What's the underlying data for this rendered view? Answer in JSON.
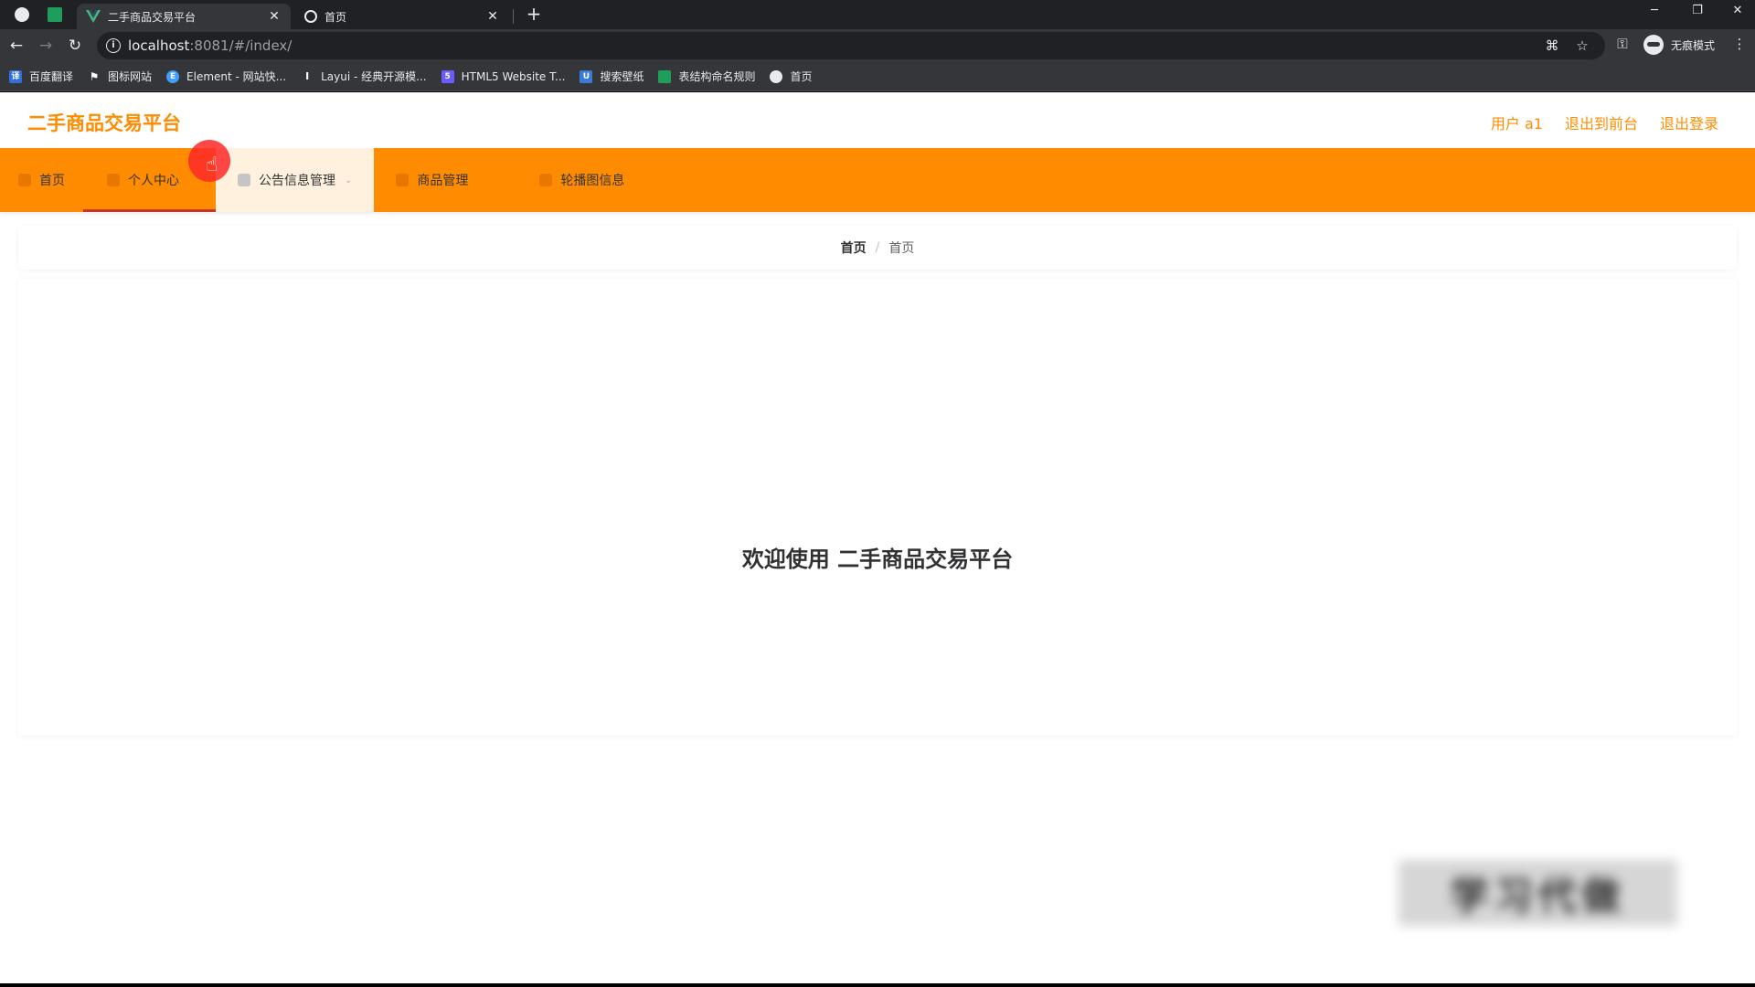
{
  "browser": {
    "tabs": [
      {
        "title": "二手商品交易平台",
        "close": "✕"
      },
      {
        "title": "首页",
        "close": "✕"
      }
    ],
    "new_tab": "+",
    "window_controls": {
      "minimize": "─",
      "restore": "❐",
      "close": "✕"
    },
    "url": {
      "host": "localhost",
      "rest": ":8081/#/index/"
    },
    "incognito_label": "无痕模式",
    "bookmarks": [
      {
        "label": "百度翻译",
        "icon": "baidu-translate-icon",
        "color": "#2f6fe0"
      },
      {
        "label": "图标网站",
        "icon": "flag-icon",
        "color": "#3c4043"
      },
      {
        "label": "Element - 网站快...",
        "icon": "element-icon",
        "color": "#409eff"
      },
      {
        "label": "Layui - 经典开源模...",
        "icon": "layui-icon",
        "color": "#3c4043"
      },
      {
        "label": "HTML5 Website T...",
        "icon": "html5-template-icon",
        "color": "#6b5cff"
      },
      {
        "label": "搜索壁纸",
        "icon": "wallpaper-icon",
        "color": "#3a7bd5"
      },
      {
        "label": "表结构命名规则",
        "icon": "sheet-icon",
        "color": "#1e9e5a"
      },
      {
        "label": "首页",
        "icon": "globe-icon",
        "color": "#3c4043"
      }
    ]
  },
  "app": {
    "brand": "二手商品交易平台",
    "user_links": [
      "用户 a1",
      "退出到前台",
      "退出登录"
    ],
    "menu": [
      {
        "label": "首页",
        "icon": "home-icon"
      },
      {
        "label": "个人中心",
        "icon": "user-icon"
      },
      {
        "label": "公告信息管理",
        "icon": "notice-icon",
        "caret": "⌄"
      },
      {
        "label": "商品管理",
        "icon": "goods-icon"
      },
      {
        "label": "轮播图信息",
        "icon": "carousel-icon"
      }
    ],
    "breadcrumb": {
      "home": "首页",
      "separator": "/",
      "current": "首页"
    },
    "welcome": "欢迎使用 二手商品交易平台",
    "watermark": "学习代做",
    "accent_color": "#ff8c00"
  }
}
